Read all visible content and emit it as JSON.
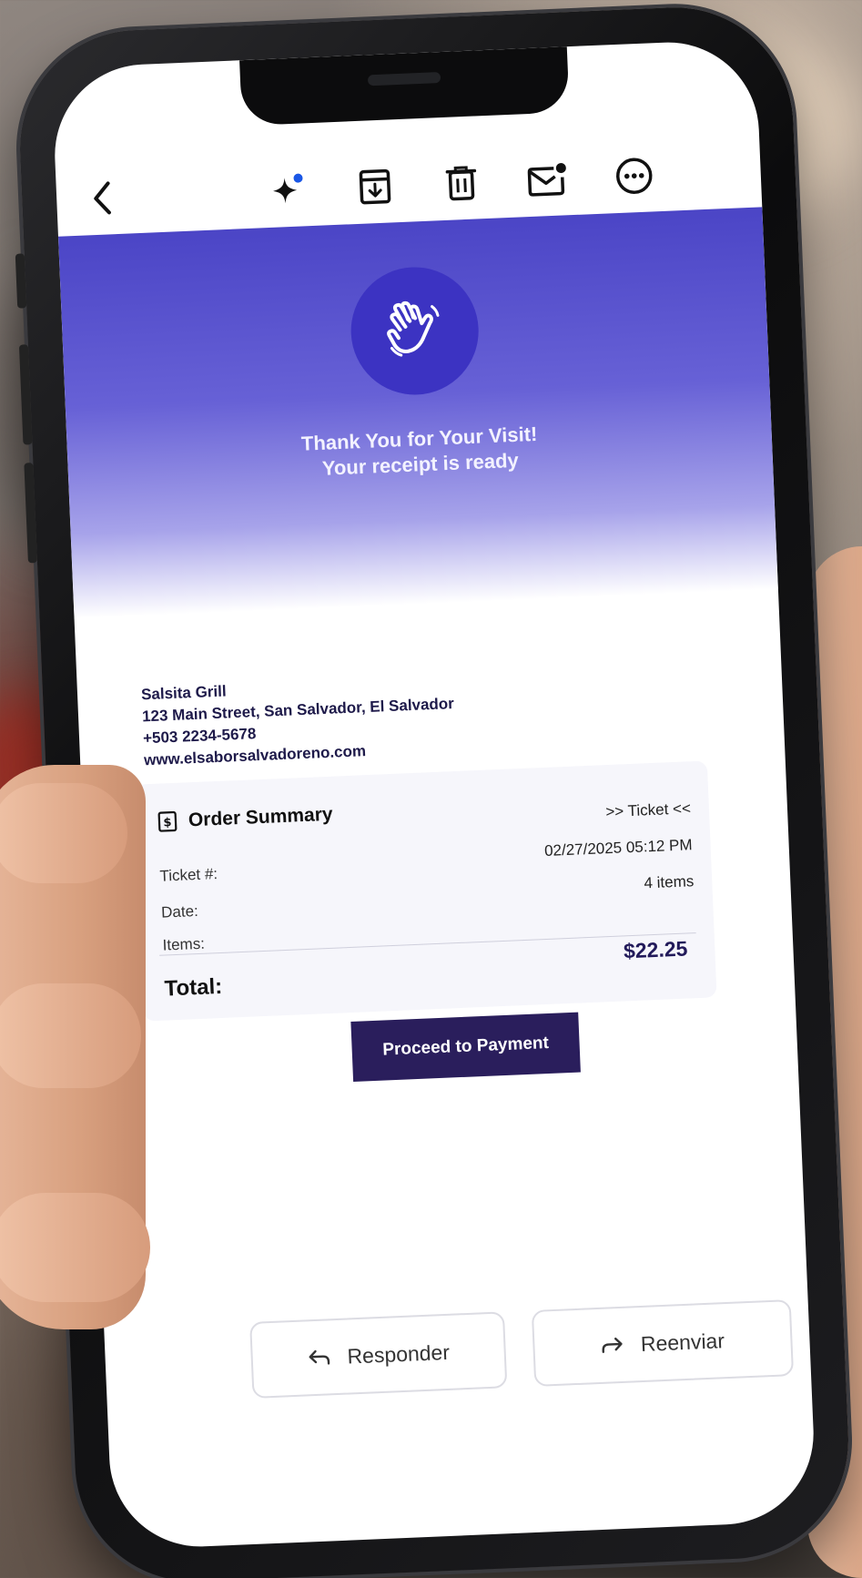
{
  "toolbar": {
    "back_icon": "chevron-left-icon",
    "actions": [
      "sparkle-icon",
      "archive-icon",
      "trash-icon",
      "mark-unread-icon",
      "more-icon"
    ]
  },
  "hero": {
    "icon": "waving-hand-icon",
    "title_line1": "Thank You for Your Visit!",
    "title_line2": "Your receipt is ready",
    "gradient_top": "#4b45c6",
    "circle_color": "#3c33c2"
  },
  "business": {
    "name": "Salsita Grill",
    "address": "123 Main Street, San Salvador, El Salvador",
    "phone": "+503 2234-5678",
    "website": "www.elsaborsalvadoreno.com"
  },
  "order_summary": {
    "heading": "Order Summary",
    "icon": "dollar-receipt-icon",
    "labels": {
      "ticket": "Ticket #:",
      "date": "Date:",
      "items": "Items:",
      "total": "Total:"
    },
    "values": {
      "ticket": ">> Ticket <<",
      "date": "02/27/2025 05:12 PM",
      "items": "4 items",
      "total": "$22.25"
    }
  },
  "payment_button": {
    "label": "Proceed to Payment",
    "color": "#2a1e5c"
  },
  "footer": {
    "reply_label": "Responder",
    "forward_label": "Reenviar"
  }
}
